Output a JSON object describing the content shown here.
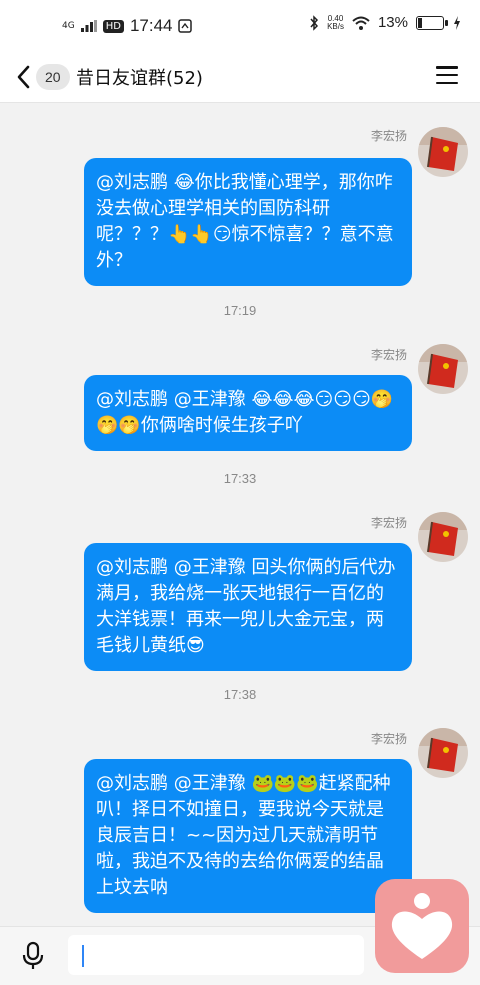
{
  "status_bar": {
    "network": "4G",
    "hd": "HD",
    "time": "17:44",
    "speed_value": "0.40",
    "speed_unit": "KB/s",
    "battery": "13%"
  },
  "header": {
    "back_count": "20",
    "title": "昔日友谊群(52)"
  },
  "messages": [
    {
      "sender": "李宏扬",
      "text": "@刘志鹏 😂你比我懂心理学，那你咋没去做心理学相关的国防科研呢？？？👆👆😏惊不惊喜？？意不意外？"
    },
    {
      "sender": "李宏扬",
      "text": "@刘志鹏 @王津豫 😂😂😂😏😏😏🤭🤭🤭你俩啥时候生孩子吖"
    },
    {
      "sender": "李宏扬",
      "text": "@刘志鹏 @王津豫 回头你俩的后代办满月，我给烧一张天地银行一百亿的大洋钱票！再来一兜儿大金元宝，两毛钱儿黄纸😎"
    },
    {
      "sender": "李宏扬",
      "text": "@刘志鹏 @王津豫 🐸🐸🐸赶紧配种叭！择日不如撞日，要我说今天就是良辰吉日！~~因为过几天就清明节啦，我迫不及待的去给你俩爱的结晶 上坟去呐"
    }
  ],
  "timestamps": [
    "17:19",
    "17:33",
    "17:38"
  ],
  "input": {
    "placeholder": ""
  },
  "colors": {
    "bubble": "#0c8cf6",
    "background": "#f2f2f2",
    "floating_app": "#f19b9b"
  },
  "icons": [
    "back-arrow-icon",
    "menu-icon",
    "mic-icon",
    "heart-icon",
    "wifi-icon",
    "bluetooth-icon",
    "battery-icon"
  ]
}
